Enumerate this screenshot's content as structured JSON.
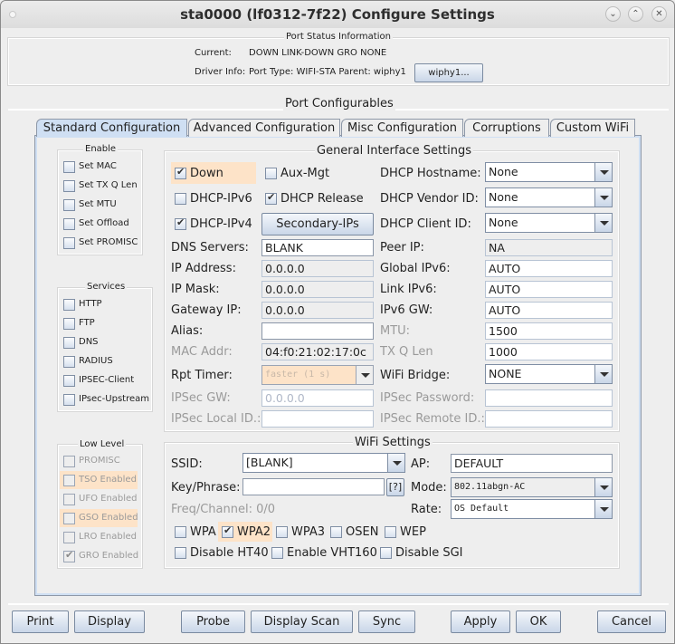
{
  "window": {
    "title": "sta0000  (lf0312-7f22) Configure Settings",
    "controls": [
      "minimize-icon",
      "maximize-icon",
      "close-icon"
    ]
  },
  "port_status": {
    "title": "Port Status Information",
    "current_label": "Current:",
    "current_value": "DOWN LINK-DOWN GRO  NONE",
    "driver_label": "Driver Info:",
    "driver_value": "Port Type: WIFI-STA   Parent: wiphy1",
    "parent_button": "wiphy1..."
  },
  "configurables_title": "Port Configurables",
  "tabs": [
    {
      "label": "Standard Configuration",
      "active": true
    },
    {
      "label": "Advanced Configuration",
      "active": false
    },
    {
      "label": "Misc Configuration",
      "active": false
    },
    {
      "label": "Corruptions",
      "active": false
    },
    {
      "label": "Custom WiFi",
      "active": false
    }
  ],
  "enable": {
    "title": "Enable",
    "items": [
      {
        "label": "Set MAC",
        "checked": false
      },
      {
        "label": "Set TX Q Len",
        "checked": false
      },
      {
        "label": "Set MTU",
        "checked": false
      },
      {
        "label": "Set Offload",
        "checked": false
      },
      {
        "label": "Set PROMISC",
        "checked": false
      }
    ]
  },
  "services": {
    "title": "Services",
    "items": [
      {
        "label": "HTTP",
        "checked": false
      },
      {
        "label": "FTP",
        "checked": false
      },
      {
        "label": "DNS",
        "checked": false
      },
      {
        "label": "RADIUS",
        "checked": false
      },
      {
        "label": "IPSEC-Client",
        "checked": false
      },
      {
        "label": "IPsec-Upstream",
        "checked": false
      }
    ]
  },
  "low_level": {
    "title": "Low Level",
    "items": [
      {
        "label": "PROMISC",
        "checked": false,
        "highlight": false
      },
      {
        "label": "TSO Enabled",
        "checked": false,
        "highlight": true
      },
      {
        "label": "UFO Enabled",
        "checked": false,
        "highlight": false
      },
      {
        "label": "GSO Enabled",
        "checked": false,
        "highlight": true
      },
      {
        "label": "LRO Enabled",
        "checked": false,
        "highlight": false
      },
      {
        "label": "GRO Enabled",
        "checked": true,
        "highlight": false
      }
    ]
  },
  "general": {
    "title": "General Interface Settings",
    "down": {
      "label": "Down",
      "checked": true
    },
    "aux_mgt": {
      "label": "Aux-Mgt",
      "checked": false
    },
    "dhcp_ipv6": {
      "label": "DHCP-IPv6",
      "checked": false
    },
    "dhcp_release": {
      "label": "DHCP Release",
      "checked": true
    },
    "dhcp_ipv4": {
      "label": "DHCP-IPv4",
      "checked": true
    },
    "secondary_ips": "Secondary-IPs",
    "dhcp_hostname": {
      "label": "DHCP Hostname:",
      "value": "None"
    },
    "dhcp_vendor": {
      "label": "DHCP Vendor ID:",
      "value": "None"
    },
    "dhcp_client": {
      "label": "DHCP Client ID:",
      "value": "None"
    },
    "dns_servers": {
      "label": "DNS Servers:",
      "value": "BLANK"
    },
    "ip_address": {
      "label": "IP Address:",
      "value": "0.0.0.0"
    },
    "ip_mask": {
      "label": "IP Mask:",
      "value": "0.0.0.0"
    },
    "gateway_ip": {
      "label": "Gateway IP:",
      "value": "0.0.0.0"
    },
    "alias": {
      "label": "Alias:",
      "value": ""
    },
    "mac_addr": {
      "label": "MAC Addr:",
      "value": "04:f0:21:02:17:0c"
    },
    "rpt_timer": {
      "label": "Rpt Timer:",
      "value": "faster  (1 s)"
    },
    "ipsec_gw": {
      "label": "IPSec GW:",
      "value": "0.0.0.0"
    },
    "ipsec_local": {
      "label": "IPSec Local ID.:",
      "value": ""
    },
    "peer_ip": {
      "label": "Peer IP:",
      "value": "NA"
    },
    "global_ipv6": {
      "label": "Global IPv6:",
      "value": "AUTO"
    },
    "link_ipv6": {
      "label": "Link IPv6:",
      "value": "AUTO"
    },
    "ipv6_gw": {
      "label": "IPv6 GW:",
      "value": "AUTO"
    },
    "mtu": {
      "label": "MTU:",
      "value": "1500"
    },
    "tx_q_len": {
      "label": "TX Q Len",
      "value": "1000"
    },
    "wifi_bridge": {
      "label": "WiFi Bridge:",
      "value": "NONE"
    },
    "ipsec_password": {
      "label": "IPSec Password:",
      "value": ""
    },
    "ipsec_remote": {
      "label": "IPSec Remote ID.:",
      "value": ""
    }
  },
  "wifi": {
    "title": "WiFi Settings",
    "ssid": {
      "label": "SSID:",
      "value": "[BLANK]"
    },
    "ap": {
      "label": "AP:",
      "value": "DEFAULT"
    },
    "key": {
      "label": "Key/Phrase:",
      "value": "",
      "help": "[?]"
    },
    "mode": {
      "label": "Mode:",
      "value": "802.11abgn-AC"
    },
    "rate": {
      "label": "Rate:",
      "value": "OS Default"
    },
    "freq": "Freq/Channel: 0/0",
    "wpa": {
      "label": "WPA",
      "checked": false
    },
    "wpa2": {
      "label": "WPA2",
      "checked": true
    },
    "wpa3": {
      "label": "WPA3",
      "checked": false
    },
    "osen": {
      "label": "OSEN",
      "checked": false
    },
    "wep": {
      "label": "WEP",
      "checked": false
    },
    "disable_ht40": {
      "label": "Disable HT40",
      "checked": false
    },
    "enable_vht160": {
      "label": "Enable VHT160",
      "checked": false
    },
    "disable_sgi": {
      "label": "Disable SGI",
      "checked": false
    }
  },
  "buttons": {
    "print": "Print",
    "display": "Display",
    "probe": "Probe",
    "display_scan": "Display Scan",
    "sync": "Sync",
    "apply": "Apply",
    "ok": "OK",
    "cancel": "Cancel"
  },
  "colors": {
    "highlight": "#fde3c8",
    "tab_active": "#cfdff3",
    "button_bottom": "#c9d6e8"
  }
}
